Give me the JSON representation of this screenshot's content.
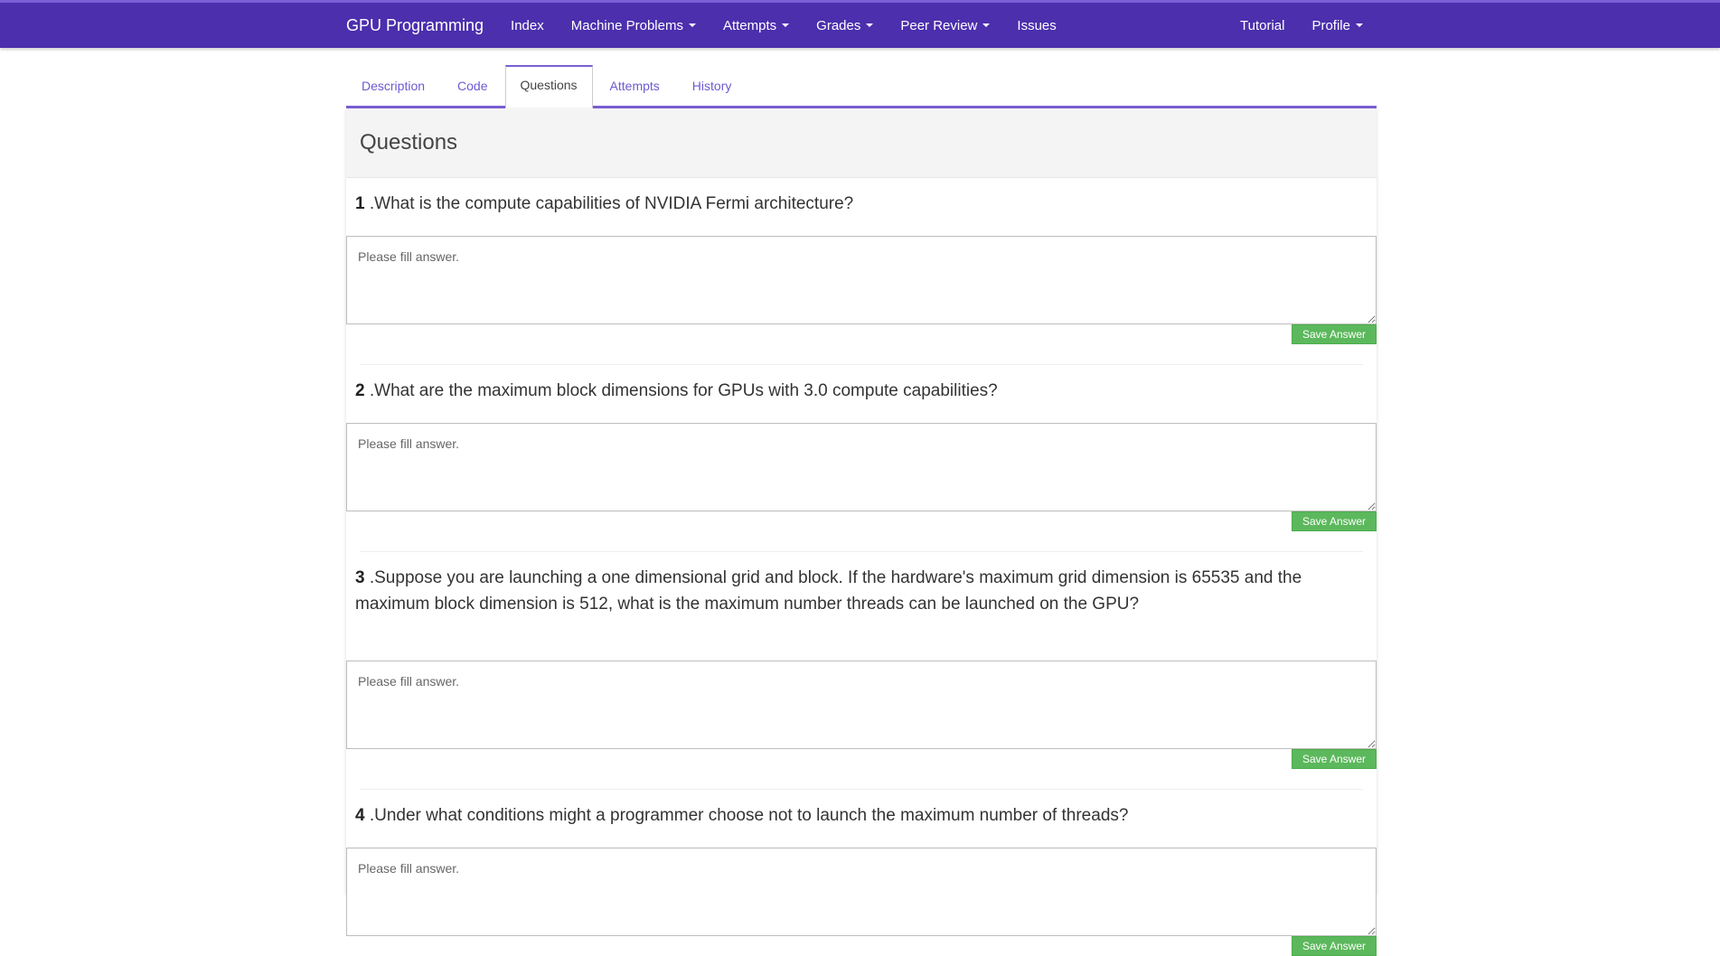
{
  "navbar": {
    "brand": "GPU Programming",
    "links": [
      {
        "label": "Index",
        "dropdown": false
      },
      {
        "label": "Machine Problems",
        "dropdown": true
      },
      {
        "label": "Attempts",
        "dropdown": true
      },
      {
        "label": "Grades",
        "dropdown": true
      },
      {
        "label": "Peer Review",
        "dropdown": true
      },
      {
        "label": "Issues",
        "dropdown": false
      }
    ],
    "right_links": [
      {
        "label": "Tutorial",
        "dropdown": false
      },
      {
        "label": "Profile",
        "dropdown": true
      }
    ],
    "color": "#4b2fad"
  },
  "tabs": [
    {
      "label": "Description",
      "active": false
    },
    {
      "label": "Code",
      "active": false
    },
    {
      "label": "Questions",
      "active": true
    },
    {
      "label": "Attempts",
      "active": false
    },
    {
      "label": "History",
      "active": false
    }
  ],
  "panel": {
    "title": "Questions"
  },
  "questions": [
    {
      "number": "1",
      "text": " .What is the compute capabilities of NVIDIA Fermi architecture?",
      "placeholder": "Please fill answer.",
      "value": "",
      "save_label": "Save Answer"
    },
    {
      "number": "2",
      "text": " .What are the maximum block dimensions for GPUs with 3.0 compute capabilities?",
      "placeholder": "Please fill answer.",
      "value": "",
      "save_label": "Save Answer"
    },
    {
      "number": "3",
      "text": " .Suppose you are launching a one dimensional grid and block. If the hardware's maximum grid dimension is 65535 and the maximum block dimension is 512, what is the maximum number threads can be launched on the GPU?",
      "placeholder": "Please fill answer.",
      "value": "",
      "save_label": "Save Answer"
    },
    {
      "number": "4",
      "text": " .Under what conditions might a programmer choose not to launch the maximum number of threads?",
      "placeholder": "Please fill answer.",
      "value": "",
      "save_label": "Save Answer"
    }
  ],
  "colors": {
    "accent": "#7b5fd6",
    "save_button": "#5cb85c"
  }
}
